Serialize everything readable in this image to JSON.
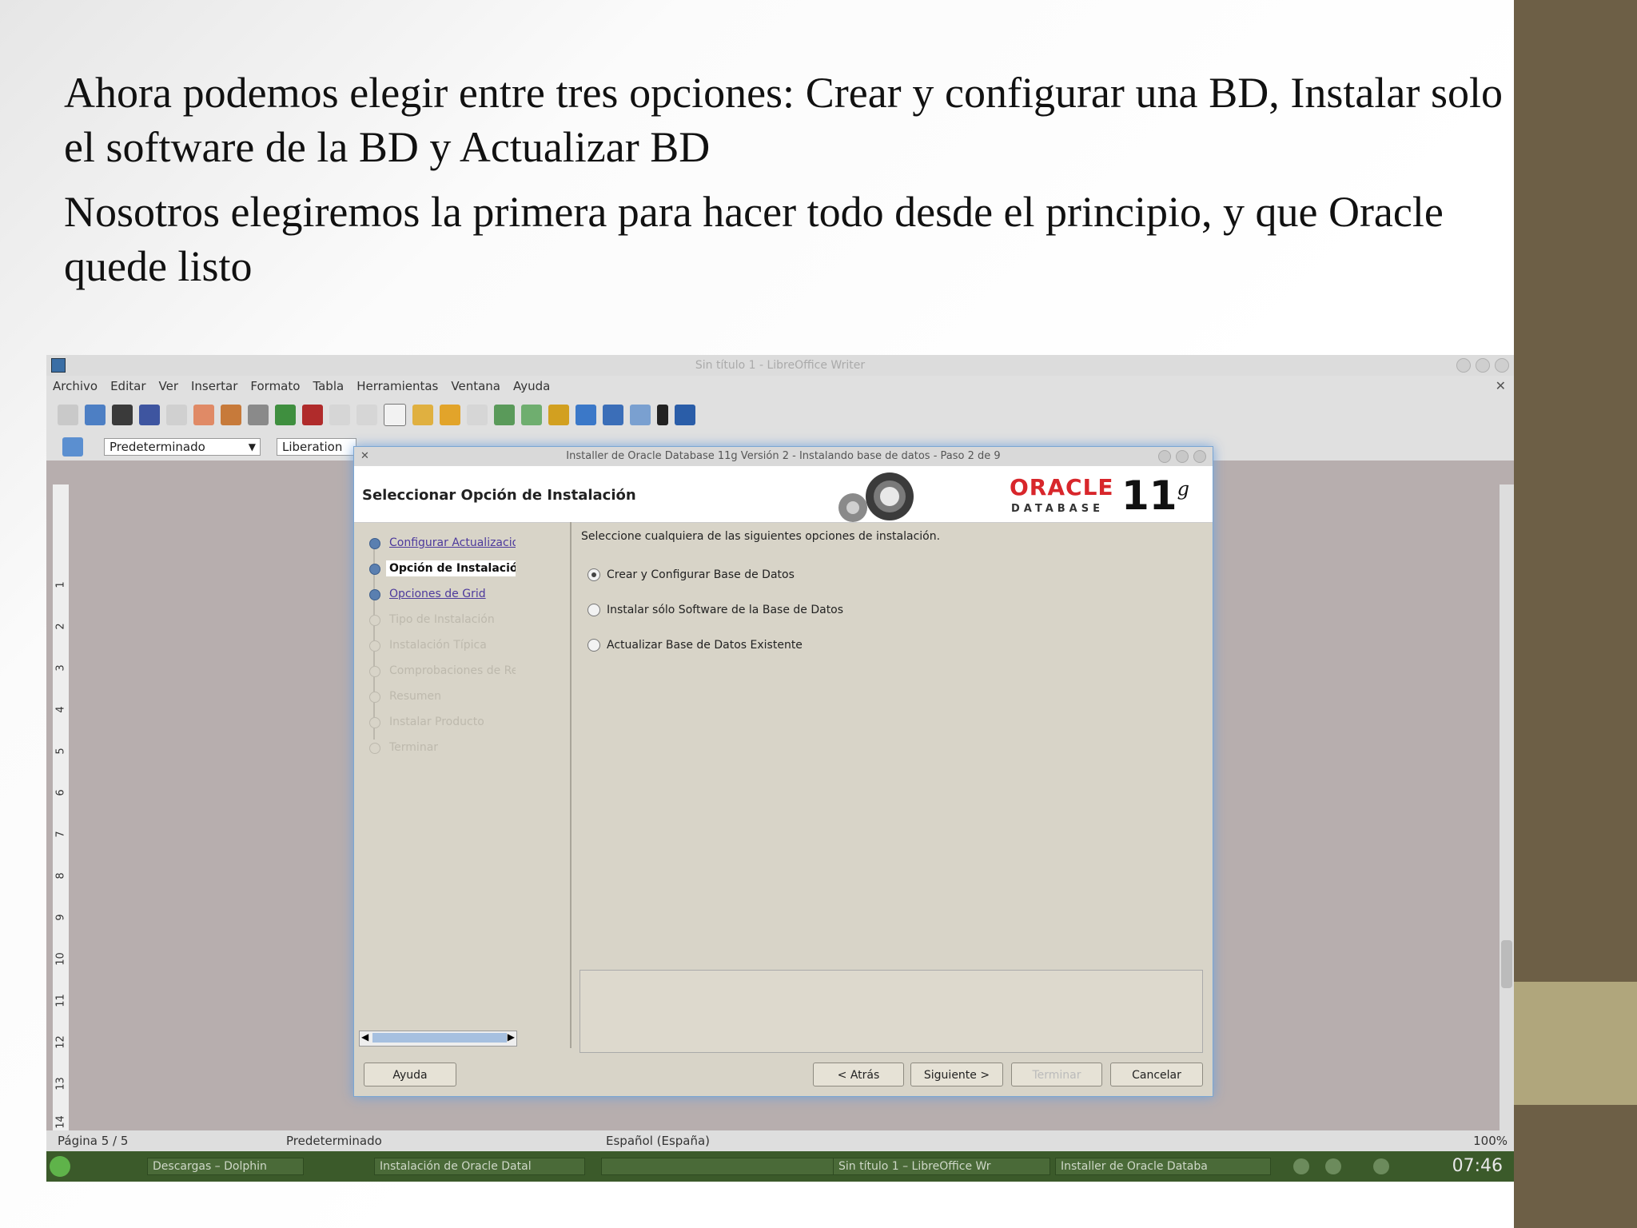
{
  "slide": {
    "paragraph1": "Ahora podemos elegir entre tres opciones: Crear y configurar una BD, Instalar solo el software de la BD y Actualizar BD",
    "paragraph2": "Nosotros elegiremos la primera para hacer todo desde el principio, y que Oracle quede listo",
    "colors": {
      "sidebar_dark": "#6d5f46",
      "sidebar_light": "#b0a67c"
    }
  },
  "writer": {
    "window_title": "Sin título 1 - LibreOffice Writer",
    "menu": [
      "Archivo",
      "Editar",
      "Ver",
      "Insertar",
      "Formato",
      "Tabla",
      "Herramientas",
      "Ventana",
      "Ayuda"
    ],
    "style_select": "Predeterminado",
    "font_select": "Liberation",
    "ruler_numbers": [
      "1",
      "2",
      "3",
      "4",
      "5",
      "6",
      "7",
      "8",
      "9",
      "10",
      "11",
      "12",
      "13",
      "14"
    ],
    "status": {
      "page": "Página 5 / 5",
      "style": "Predeterminado",
      "language": "Español (España)",
      "zoom": "100%"
    }
  },
  "installer": {
    "title": "Installer de Oracle Database 11g Versión 2 - Instalando base de datos - Paso 2 de 9",
    "heading": "Seleccionar Opción de Instalación",
    "logo": {
      "brand": "ORACLE",
      "product": "DATABASE",
      "version": "11",
      "version_sup": "g"
    },
    "steps": [
      {
        "label": "Configurar Actualizaciones de",
        "state": "done"
      },
      {
        "label": "Opción de Instalación",
        "state": "current"
      },
      {
        "label": "Opciones de Grid",
        "state": "done"
      },
      {
        "label": "Tipo de Instalación",
        "state": "pending"
      },
      {
        "label": "Instalación Típica",
        "state": "pending"
      },
      {
        "label": "Comprobaciones de Requisitos",
        "state": "pending"
      },
      {
        "label": "Resumen",
        "state": "pending"
      },
      {
        "label": "Instalar Producto",
        "state": "pending"
      },
      {
        "label": "Terminar",
        "state": "pending"
      }
    ],
    "prompt": "Seleccione cualquiera de las siguientes opciones de instalación.",
    "options": [
      {
        "label": "Crear y Configurar Base de Datos",
        "checked": true
      },
      {
        "label": "Instalar sólo Software de la Base de Datos",
        "checked": false
      },
      {
        "label": "Actualizar Base de Datos Existente",
        "checked": false
      }
    ],
    "buttons": {
      "help": "Ayuda",
      "back": "< Atrás",
      "next": "Siguiente >",
      "finish": "Terminar",
      "cancel": "Cancelar"
    }
  },
  "taskbar": {
    "tasks": [
      "Descargas – Dolphin",
      "Instalación de Oracle Datal",
      "",
      "Sin título 1 – LibreOffice Wr",
      "Installer de Oracle Databa"
    ],
    "clock": "07:46"
  }
}
